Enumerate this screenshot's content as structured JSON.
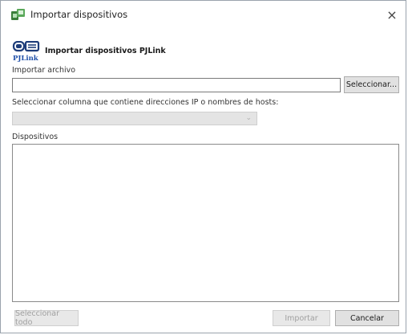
{
  "window": {
    "title": "Importar dispositivos",
    "close_glyph": "×"
  },
  "logo": {
    "icon": "pjlink-logo-icon",
    "text": "PJLink"
  },
  "heading": "Importar dispositivos PJLink",
  "import_file": {
    "label": "Importar archivo",
    "value": "",
    "browse_label": "Seleccionar..."
  },
  "column_select": {
    "label": "Seleccionar columna que contiene direcciones IP o nombres de hosts:",
    "value": ""
  },
  "devices": {
    "label": "Dispositivos",
    "items": []
  },
  "footer": {
    "select_all_label": "Seleccionar todo",
    "import_label": "Importar",
    "cancel_label": "Cancelar"
  }
}
